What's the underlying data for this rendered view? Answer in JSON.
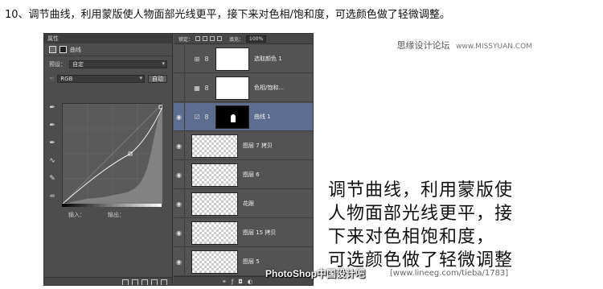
{
  "step_title": "10、调节曲线，利用蒙版使人物面部光线更平，接下来对色相/饱和度，可选颜色做了轻微调整。",
  "watermark": {
    "site": "思缘设计论坛",
    "url": "www.MISSYUAN.COM"
  },
  "properties_panel": {
    "header": "属性",
    "title": "曲线",
    "preset_label": "预设：",
    "preset_value": "自定",
    "channel_value": "RGB",
    "auto_button": "自动",
    "input_label": "输入：",
    "output_label": "输出："
  },
  "layers_panel": {
    "lock_label": "锁定：",
    "fill_label": "填充：",
    "fill_value": "100%",
    "layers": [
      {
        "name": "选取颜色 1",
        "type": "adjustment",
        "visible": false,
        "selected": false
      },
      {
        "name": "色相/饱和...",
        "type": "adjustment",
        "visible": false,
        "selected": false
      },
      {
        "name": "曲线 1",
        "type": "adjustment",
        "visible": true,
        "selected": true
      },
      {
        "name": "图层 7 拷贝",
        "type": "pixel",
        "visible": true,
        "selected": false
      },
      {
        "name": "图层 6",
        "type": "pixel",
        "visible": true,
        "selected": false
      },
      {
        "name": "花跟",
        "type": "pixel",
        "visible": true,
        "selected": false
      },
      {
        "name": "图层 15 拷贝",
        "type": "pixel",
        "visible": true,
        "selected": false
      },
      {
        "name": "图层 5",
        "type": "pixel",
        "visible": true,
        "selected": false
      }
    ]
  },
  "ps_watermark": {
    "brand": "PhotoShop中国设计吧",
    "url": "[www.lineeg.com/tieba/1783]"
  },
  "caption_lines": [
    "调节曲线，利用蒙版使",
    "人物面部光线更平，接",
    "下来对色相饱和度，",
    "可选颜色做了轻微调整"
  ]
}
